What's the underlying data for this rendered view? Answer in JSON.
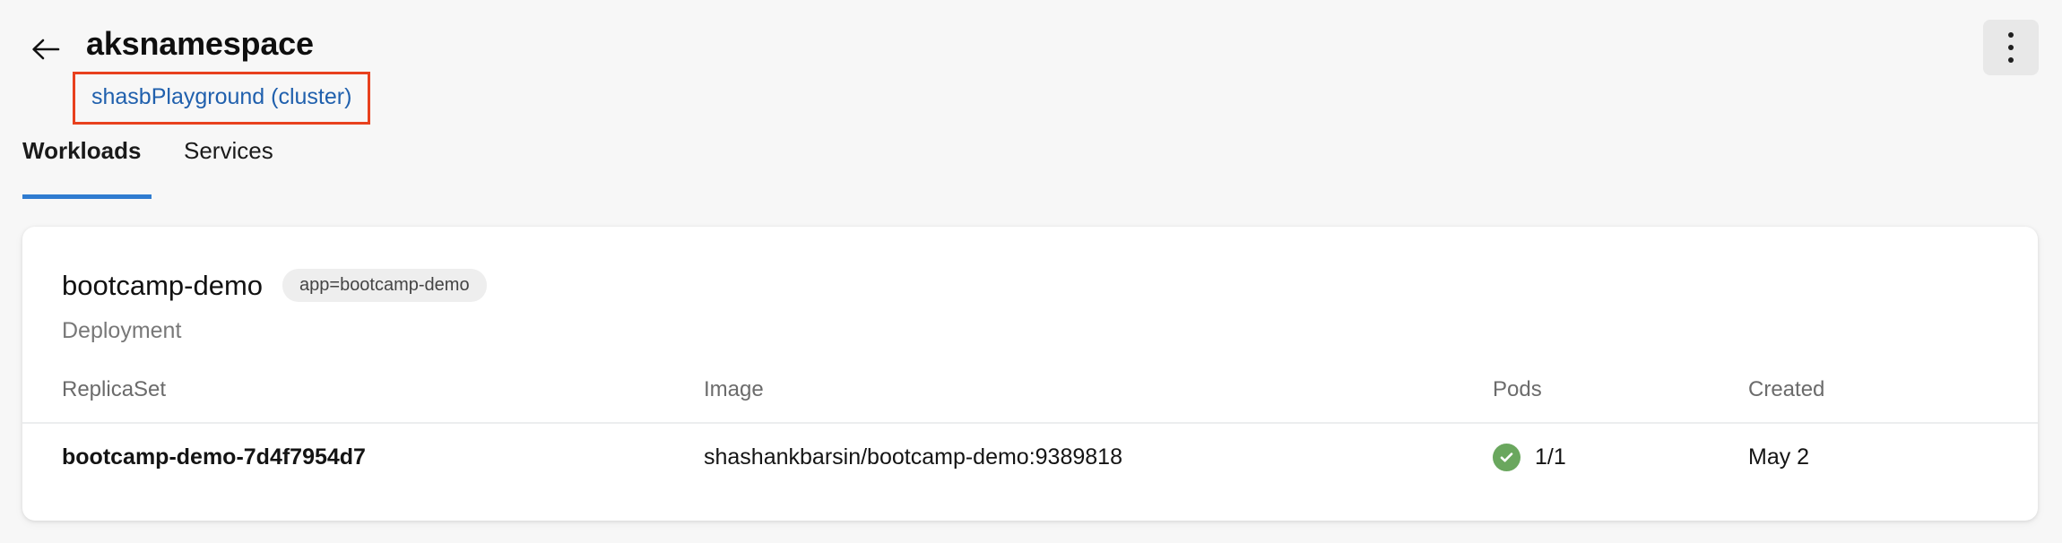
{
  "header": {
    "back_icon": "back-arrow-icon",
    "title": "aksnamespace",
    "cluster_link": "shasbPlayground (cluster)",
    "annotation_color": "#e8411e",
    "link_color": "#2060ad",
    "more_menu_icon": "kebab-menu-icon"
  },
  "tabs": {
    "items": [
      {
        "label": "Workloads",
        "active": true
      },
      {
        "label": "Services",
        "active": false
      }
    ],
    "active_underline_color": "#2f7cd0",
    "filter_icon": "filter-funnel-icon"
  },
  "card": {
    "workload_name": "bootcamp-demo",
    "workload_badge": "app=bootcamp-demo",
    "workload_kind": "Deployment",
    "table": {
      "columns": [
        "ReplicaSet",
        "Image",
        "Pods",
        "Created"
      ],
      "rows": [
        {
          "replicaset": "bootcamp-demo-7d4f7954d7",
          "image": "shashankbarsin/bootcamp-demo:9389818",
          "pods": "1/1",
          "pods_status_icon": "check-circle-icon",
          "pods_status_color": "#6aa75e",
          "created": "May 2"
        }
      ]
    }
  }
}
